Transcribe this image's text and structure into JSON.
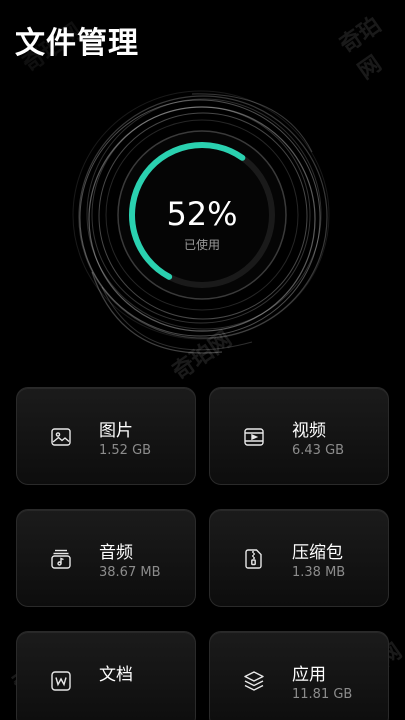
{
  "header": {
    "title": "文件管理"
  },
  "usage": {
    "percent_text": "52%",
    "label": "已使用",
    "percent": 52,
    "accent": "#2ad1b0"
  },
  "watermark": "奇珀网",
  "categories": [
    {
      "name": "图片",
      "size": "1.52 GB",
      "icon": "image-icon"
    },
    {
      "name": "视频",
      "size": "6.43 GB",
      "icon": "video-icon"
    },
    {
      "name": "音频",
      "size": "38.67 MB",
      "icon": "audio-icon"
    },
    {
      "name": "压缩包",
      "size": "1.38 MB",
      "icon": "zip-icon"
    },
    {
      "name": "文档",
      "size": "",
      "icon": "document-icon"
    },
    {
      "name": "应用",
      "size": "11.81 GB",
      "icon": "apps-icon"
    }
  ]
}
